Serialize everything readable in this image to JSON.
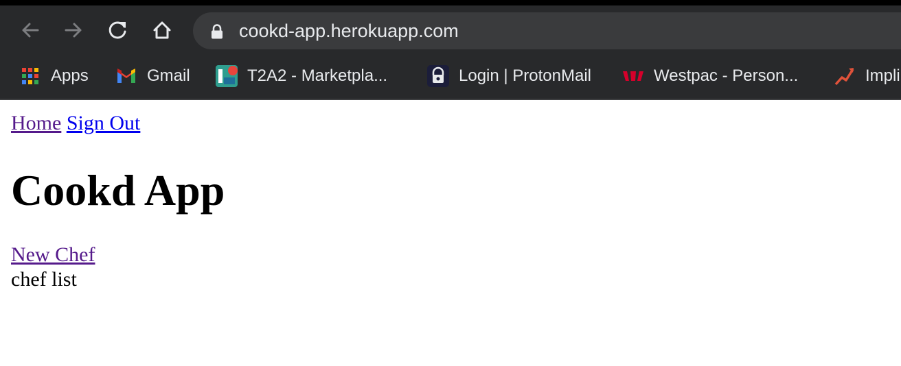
{
  "browser": {
    "url": "cookd-app.herokuapp.com",
    "toolbar_icons": [
      "back-arrow-icon",
      "forward-arrow-icon",
      "reload-icon",
      "home-icon",
      "lock-icon"
    ],
    "bookmarks": [
      {
        "label": "Apps",
        "icon": "apps-grid-icon"
      },
      {
        "label": "Gmail",
        "icon": "gmail-icon"
      },
      {
        "label": "T2A2 - Marketpla...",
        "icon": "trello-icon"
      },
      {
        "label": "Login | ProtonMail",
        "icon": "protonmail-icon"
      },
      {
        "label": "Westpac - Person...",
        "icon": "westpac-icon"
      },
      {
        "label": "Impli",
        "icon": "chart-trend-icon"
      }
    ]
  },
  "page": {
    "nav": {
      "home": "Home",
      "sign_out": "Sign Out"
    },
    "title": "Cookd App",
    "new_chef_link": "New Chef",
    "chef_list_text": "chef list"
  }
}
